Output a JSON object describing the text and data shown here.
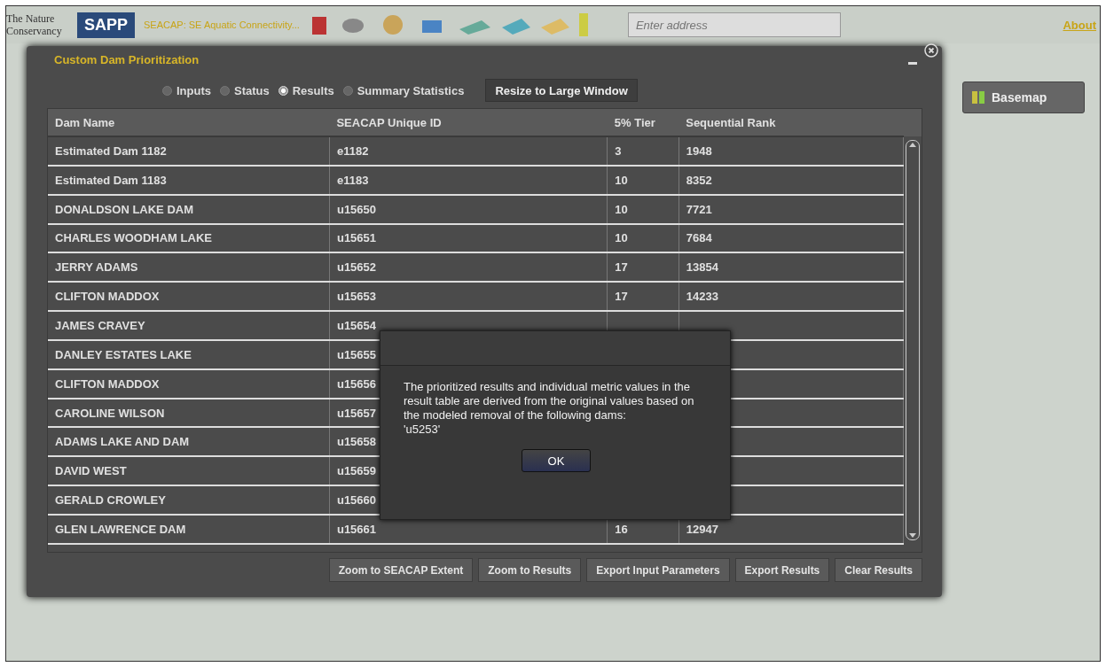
{
  "header": {
    "logo_text": "The Nature Conservancy",
    "partner_logo_text": "SAPP",
    "app_title": "SEACAP: SE Aquatic Connectivity...",
    "search": {
      "placeholder": "Enter address"
    },
    "about_link": "About"
  },
  "basemap_button": "Basemap",
  "window": {
    "title": "Custom Dam Prioritization",
    "tabs": [
      {
        "label": "Inputs",
        "selected": false
      },
      {
        "label": "Status",
        "selected": false
      },
      {
        "label": "Results",
        "selected": true
      },
      {
        "label": "Summary Statistics",
        "selected": false
      }
    ],
    "resize_button": "Resize to Large Window",
    "table": {
      "columns": [
        "Dam Name",
        "SEACAP Unique ID",
        "5% Tier",
        "Sequential Rank"
      ],
      "rows": [
        [
          "Estimated Dam 1182",
          "e1182",
          "3",
          "1948"
        ],
        [
          "Estimated Dam 1183",
          "e1183",
          "10",
          "8352"
        ],
        [
          "DONALDSON LAKE DAM",
          "u15650",
          "10",
          "7721"
        ],
        [
          "CHARLES WOODHAM LAKE",
          "u15651",
          "10",
          "7684"
        ],
        [
          "JERRY ADAMS",
          "u15652",
          "17",
          "13854"
        ],
        [
          "CLIFTON MADDOX",
          "u15653",
          "17",
          "14233"
        ],
        [
          "JAMES CRAVEY",
          "u15654",
          "",
          ""
        ],
        [
          "DANLEY ESTATES LAKE",
          "u15655",
          "",
          ""
        ],
        [
          "CLIFTON MADDOX",
          "u15656",
          "",
          ""
        ],
        [
          "CAROLINE WILSON",
          "u15657",
          "",
          ""
        ],
        [
          "ADAMS LAKE AND DAM",
          "u15658",
          "",
          ""
        ],
        [
          "DAVID WEST",
          "u15659",
          "",
          ""
        ],
        [
          "GERALD CROWLEY",
          "u15660",
          "",
          ""
        ],
        [
          "GLEN LAWRENCE DAM",
          "u15661",
          "16",
          "12947"
        ]
      ]
    },
    "buttons": [
      "Zoom to SEACAP Extent",
      "Zoom to Results",
      "Export Input Parameters",
      "Export Results",
      "Clear Results"
    ]
  },
  "dialog": {
    "message": "The prioritized results and individual metric values in the result table are derived from the original values based on the modeled removal of the following dams:",
    "dam_list": "'u5253'",
    "ok_button": "OK"
  }
}
